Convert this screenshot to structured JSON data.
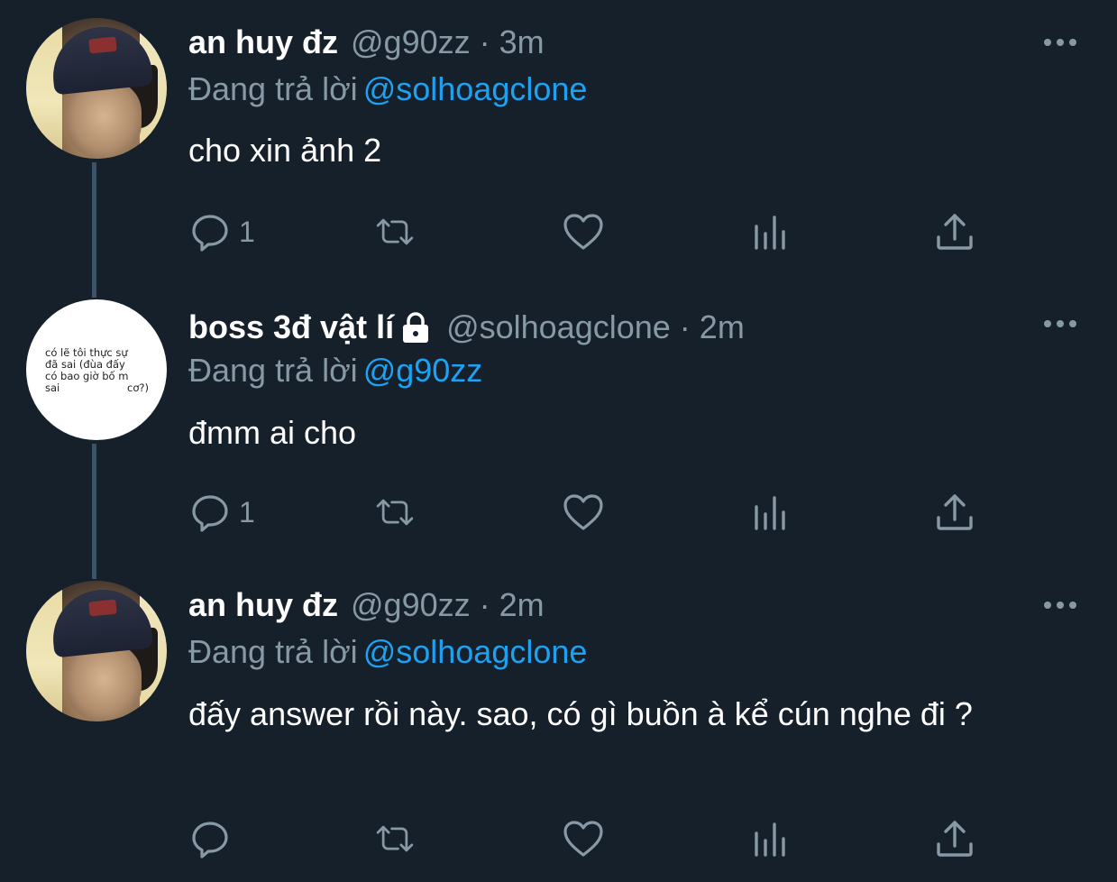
{
  "tweets": [
    {
      "name": "an huy đz",
      "handle": "@g90zz",
      "dot": "·",
      "time": "3m",
      "reply_prefix": "Đang trả lời",
      "reply_to": "@solhoagclone",
      "text": "cho xin ảnh 2",
      "reply_count": "1",
      "avatar_icon": "profile-photo",
      "locked": false
    },
    {
      "name": "boss 3đ vật lí",
      "handle": "@solhoagclone",
      "dot": "·",
      "time": "2m",
      "reply_prefix": "Đang trả lời",
      "reply_to": "@g90zz",
      "text": "đmm ai cho",
      "reply_count": "1",
      "avatar_icon": "text-quote-avatar",
      "avatar_quote": {
        "line1_left": "có lẽ tôi thực sự",
        "line2_left": "đã sai (đùa đấy",
        "line3_left": "có bao giờ bố m",
        "line4_left": "sai",
        "line4_right": "cơ?)"
      },
      "locked": true
    },
    {
      "name": "an huy đz",
      "handle": "@g90zz",
      "dot": "·",
      "time": "2m",
      "reply_prefix": "Đang trả lời",
      "reply_to": "@solhoagclone",
      "text": "đấy answer rồi này. sao, có gì buồn à kể cún nghe đi ?",
      "reply_count": "",
      "avatar_icon": "profile-photo",
      "locked": false
    }
  ],
  "colors": {
    "background": "#15202b",
    "secondary_text": "#8899a6",
    "mention": "#1da1f2",
    "thread_line": "#3d5466"
  }
}
